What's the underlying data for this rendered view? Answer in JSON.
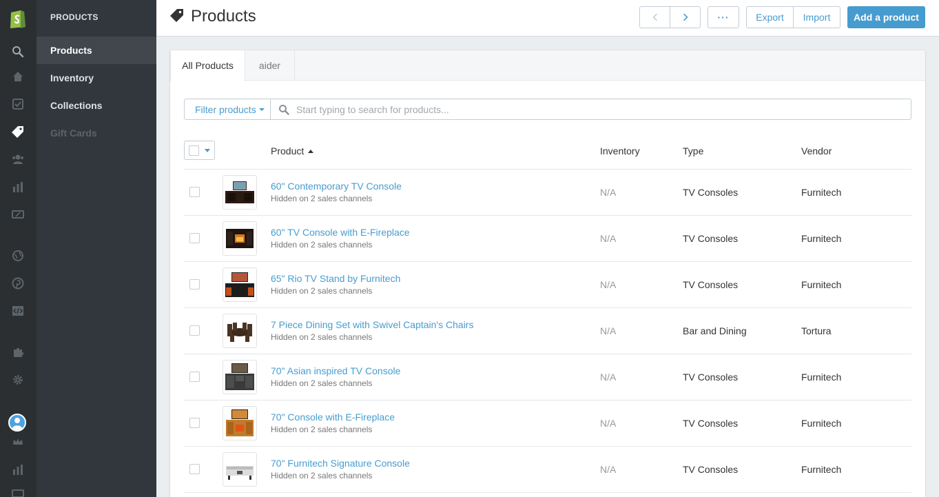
{
  "colors": {
    "accent": "#479ccf",
    "rail_bg": "#2b2f32",
    "subnav_bg": "#31373d",
    "shopify_green": "#95bf47"
  },
  "rail": {
    "icons": [
      "shopify-logo-icon",
      "search-icon",
      "home-icon",
      "orders-icon",
      "tag-icon",
      "customers-icon",
      "reports-icon",
      "discounts-icon",
      "globe-icon",
      "pinterest-icon",
      "code-icon",
      "puzzle-icon",
      "gear-icon",
      "avatar",
      "crown-icon",
      "chart-icon",
      "discounts-icon"
    ]
  },
  "subnav": {
    "title": "PRODUCTS",
    "items": [
      {
        "label": "Products"
      },
      {
        "label": "Inventory"
      },
      {
        "label": "Collections"
      },
      {
        "label": "Gift Cards"
      }
    ]
  },
  "header": {
    "title": "Products",
    "more_label": "···",
    "export_label": "Export",
    "import_label": "Import",
    "add_label": "Add a product"
  },
  "tabs": [
    {
      "label": "All Products"
    },
    {
      "label": "aider"
    }
  ],
  "filter": {
    "label": "Filter products",
    "search_placeholder": "Start typing to search for products..."
  },
  "table": {
    "columns": {
      "product": "Product",
      "inventory": "Inventory",
      "type": "Type",
      "vendor": "Vendor"
    },
    "rows": [
      {
        "name": "60\" Contemporary TV Console",
        "status": "Hidden on 2 sales channels",
        "inventory": "N/A",
        "type": "TV Consoles",
        "vendor": "Furnitech"
      },
      {
        "name": "60\" TV Console with E-Fireplace",
        "status": "Hidden on 2 sales channels",
        "inventory": "N/A",
        "type": "TV Consoles",
        "vendor": "Furnitech"
      },
      {
        "name": "65\" Rio TV Stand by Furnitech",
        "status": "Hidden on 2 sales channels",
        "inventory": "N/A",
        "type": "TV Consoles",
        "vendor": "Furnitech"
      },
      {
        "name": "7 Piece Dining Set with Swivel Captain's Chairs",
        "status": "Hidden on 2 sales channels",
        "inventory": "N/A",
        "type": "Bar and Dining",
        "vendor": "Tortura"
      },
      {
        "name": "70\" Asian inspired TV Console",
        "status": "Hidden on 2 sales channels",
        "inventory": "N/A",
        "type": "TV Consoles",
        "vendor": "Furnitech"
      },
      {
        "name": "70\" Console with E-Fireplace",
        "status": "Hidden on 2 sales channels",
        "inventory": "N/A",
        "type": "TV Consoles",
        "vendor": "Furnitech"
      },
      {
        "name": "70\" Furnitech Signature Console",
        "status": "Hidden on 2 sales channels",
        "inventory": "N/A",
        "type": "TV Consoles",
        "vendor": "Furnitech"
      }
    ]
  }
}
